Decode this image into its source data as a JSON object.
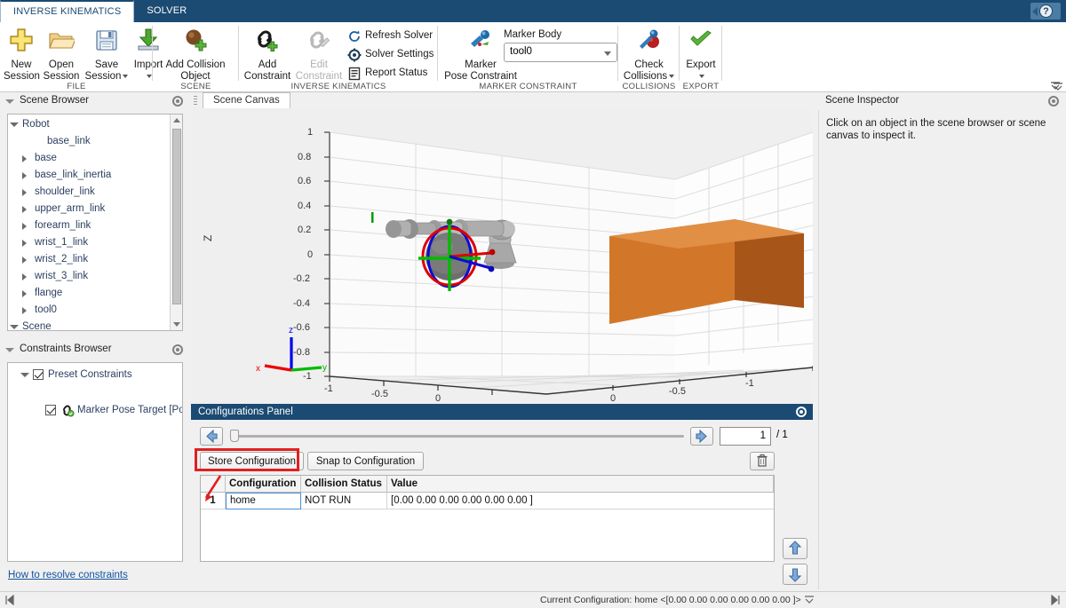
{
  "window": {
    "tabs": [
      {
        "label": "INVERSE KINEMATICS",
        "active": true
      },
      {
        "label": "SOLVER",
        "active": false
      }
    ],
    "help_glyph": "?"
  },
  "ribbon": {
    "groups": [
      {
        "name": "FILE",
        "label": "FILE",
        "buttons": [
          {
            "icon": "plus-icon",
            "line1": "New",
            "line2": "Session",
            "caret": false,
            "disabled": false
          },
          {
            "icon": "folder-open-icon",
            "line1": "Open",
            "line2": "Session",
            "caret": false,
            "disabled": false
          },
          {
            "icon": "floppy-save-icon",
            "line1": "Save",
            "line2": "Session",
            "caret": true,
            "disabled": false
          },
          {
            "icon": "import-down-arrow-icon",
            "line1": "Import",
            "line2": "",
            "caret": true,
            "disabled": false
          }
        ]
      },
      {
        "name": "SCENE",
        "label": "SCENE",
        "buttons": [
          {
            "icon": "collision-sphere-add-icon",
            "line1": "Add Collision",
            "line2": "Object",
            "caret": false,
            "disabled": false
          }
        ]
      },
      {
        "name": "INVERSE KINEMATICS",
        "label": "INVERSE KINEMATICS",
        "buttons": [
          {
            "icon": "chain-link-add-icon",
            "line1": "Add",
            "line2": "Constraint",
            "caret": false,
            "disabled": false
          },
          {
            "icon": "chain-link-edit-icon",
            "line1": "Edit",
            "line2": "Constraint",
            "caret": false,
            "disabled": true
          }
        ],
        "list_items": [
          {
            "icon": "refresh-icon",
            "label": "Refresh Solver"
          },
          {
            "icon": "gear-settings-icon",
            "label": "Solver Settings"
          },
          {
            "icon": "report-icon",
            "label": "Report Status"
          }
        ]
      },
      {
        "name": "MARKER CONSTRAINT",
        "label": "MARKER CONSTRAINT",
        "buttons": [
          {
            "icon": "marker-pose-icon",
            "line1": "Marker",
            "line2": "Pose Constraint",
            "caret": false,
            "disabled": false
          }
        ],
        "combo": {
          "label": "Marker Body",
          "value": "tool0"
        }
      },
      {
        "name": "COLLISIONS",
        "label": "COLLISIONS",
        "buttons": [
          {
            "icon": "check-collisions-icon",
            "line1": "Check",
            "line2": "Collisions",
            "caret": true,
            "disabled": false
          }
        ]
      },
      {
        "name": "EXPORT",
        "label": "EXPORT",
        "buttons": [
          {
            "icon": "green-check-icon",
            "line1": "Export",
            "line2": "",
            "caret": true,
            "disabled": false
          }
        ]
      }
    ]
  },
  "scene_browser": {
    "title": "Scene Browser",
    "nodes": [
      {
        "label": "Robot",
        "depth": 0,
        "arrow": "down"
      },
      {
        "label": "base_link",
        "depth": 2,
        "arrow": "none"
      },
      {
        "label": "base",
        "depth": 1,
        "arrow": "right"
      },
      {
        "label": "base_link_inertia",
        "depth": 1,
        "arrow": "right"
      },
      {
        "label": "shoulder_link",
        "depth": 1,
        "arrow": "right"
      },
      {
        "label": "upper_arm_link",
        "depth": 1,
        "arrow": "right"
      },
      {
        "label": "forearm_link",
        "depth": 1,
        "arrow": "right"
      },
      {
        "label": "wrist_1_link",
        "depth": 1,
        "arrow": "right"
      },
      {
        "label": "wrist_2_link",
        "depth": 1,
        "arrow": "right"
      },
      {
        "label": "wrist_3_link",
        "depth": 1,
        "arrow": "right"
      },
      {
        "label": "flange",
        "depth": 1,
        "arrow": "right"
      },
      {
        "label": "tool0",
        "depth": 1,
        "arrow": "right"
      },
      {
        "label": "Scene",
        "depth": 0,
        "arrow": "down"
      }
    ]
  },
  "constraints_browser": {
    "title": "Constraints Browser",
    "nodes": [
      {
        "label": "Preset Constraints",
        "depth": 0,
        "arrow": "down",
        "checked": true,
        "icon": ""
      },
      {
        "label": "Marker Pose Target [Pose]",
        "depth": 1,
        "arrow": "none",
        "checked": true,
        "icon": "constraint-link-icon"
      }
    ],
    "help_link": "How to resolve constraints"
  },
  "canvas": {
    "tab_label": "Scene Canvas",
    "axes": {
      "z_title": "Z",
      "z_ticks": [
        "1",
        "0.8",
        "0.6",
        "0.4",
        "0.2",
        "0",
        "-0.2",
        "-0.4",
        "-0.6",
        "-0.8",
        "-1"
      ],
      "x_ticks": [
        "-1",
        "-0.5",
        "0"
      ],
      "y_ticks": [
        "0",
        "-0.5",
        "-1"
      ]
    },
    "triad": {
      "x": "x",
      "y": "y",
      "z": "z"
    }
  },
  "scene_inspector": {
    "title": "Scene Inspector",
    "message": "Click on an object in the scene browser or scene canvas to inspect it."
  },
  "configurations_panel": {
    "title": "Configurations Panel",
    "page_value": "1",
    "page_total": "/ 1",
    "store_button": "Store Configuration",
    "snap_button": "Snap to Configuration",
    "delete_icon": "trash-icon",
    "prev_icon": "arrow-left-icon",
    "next_icon": "arrow-right-icon",
    "move_up_icon": "arrow-up-icon",
    "move_down_icon": "arrow-down-icon",
    "columns": [
      "",
      "Configuration",
      "Collision Status",
      "Value"
    ],
    "rows": [
      {
        "index": "1",
        "configuration": "home",
        "collision_status": "NOT RUN",
        "value": "[0.00 0.00 0.00 0.00 0.00 0.00 ]"
      }
    ]
  },
  "statusbar": {
    "text": "Current Configuration: home <[0.00 0.00 0.00 0.00 0.00 0.00 ]>"
  },
  "colors": {
    "accent": "#1b4a72",
    "highlight_box": "#e02020",
    "link": "#1254a0",
    "tree_text": "#2b3f60",
    "cube": "#d2772a"
  }
}
